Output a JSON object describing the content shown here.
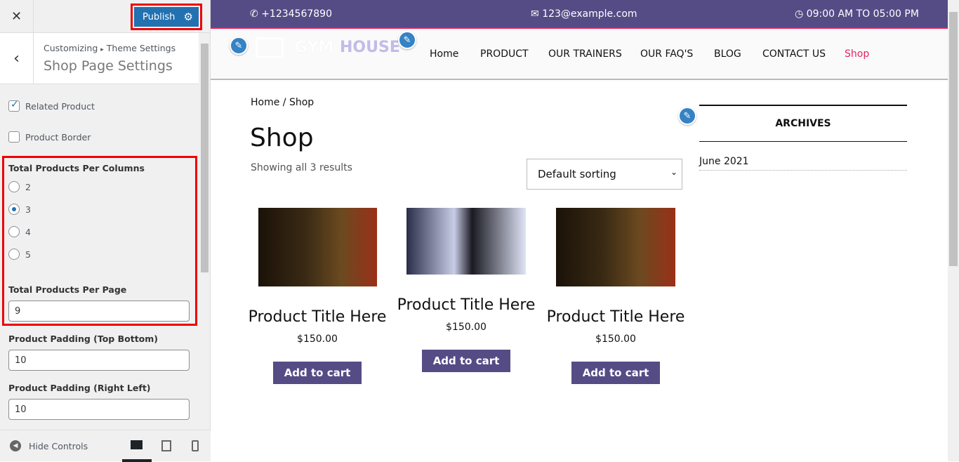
{
  "customizer": {
    "close_icon": "close-icon",
    "publish_label": "Publish",
    "breadcrumb": {
      "root": "Customizing",
      "separator": "▸",
      "parent": "Theme Settings"
    },
    "section_title": "Shop Page Settings",
    "controls": {
      "related_product": {
        "label": "Related Product",
        "checked": true
      },
      "product_border": {
        "label": "Product Border",
        "checked": false
      },
      "columns": {
        "label": "Total Products Per Columns",
        "options": [
          "2",
          "3",
          "4",
          "5"
        ],
        "selected": "3"
      },
      "per_page": {
        "label": "Total Products Per Page",
        "value": "9"
      },
      "padding_tb": {
        "label": "Product Padding (Top Bottom)",
        "value": "10"
      },
      "padding_rl": {
        "label": "Product Padding (Right Left)",
        "value": "10"
      }
    },
    "footer": {
      "hide_controls": "Hide Controls",
      "active_device": "desktop"
    }
  },
  "site": {
    "topbar": {
      "phone": "+1234567890",
      "email": "123@example.com",
      "hours": "09:00 AM TO 05:00 PM",
      "bg": "#554c86"
    },
    "logo": {
      "text1": "GYM",
      "text2": "HOUSE"
    },
    "nav": [
      "Home",
      "PRODUCT",
      "OUR TRAINERS",
      "OUR FAQ'S",
      "BLOG",
      "CONTACT US",
      "Shop"
    ],
    "nav_active": "Shop",
    "accent": "#e0245e",
    "breadcrumb": "Home / Shop",
    "page_title": "Shop",
    "results": "Showing all 3 results",
    "sorting": "Default sorting",
    "products": [
      {
        "title": "Product Title Here",
        "price": "$150.00",
        "button": "Add to cart"
      },
      {
        "title": "Product Title Here",
        "price": "$150.00",
        "button": "Add to cart"
      },
      {
        "title": "Product Title Here",
        "price": "$150.00",
        "button": "Add to cart"
      }
    ],
    "sidebar": {
      "widget_title": "ARCHIVES",
      "items": [
        "June 2021"
      ]
    }
  }
}
